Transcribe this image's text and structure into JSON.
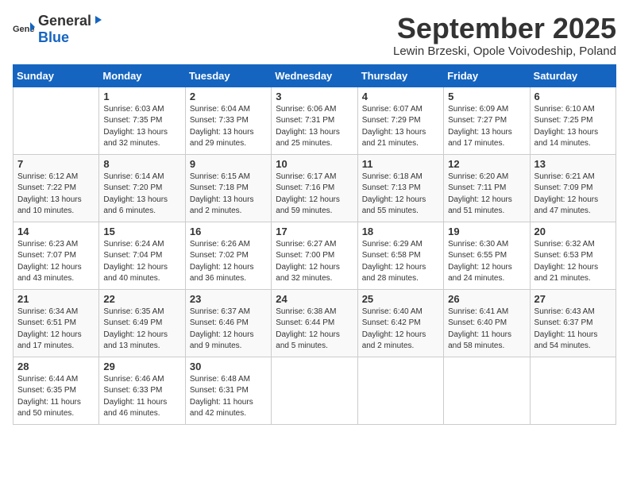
{
  "header": {
    "logo_general": "General",
    "logo_blue": "Blue",
    "month_title": "September 2025",
    "location": "Lewin Brzeski, Opole Voivodeship, Poland"
  },
  "weekdays": [
    "Sunday",
    "Monday",
    "Tuesday",
    "Wednesday",
    "Thursday",
    "Friday",
    "Saturday"
  ],
  "weeks": [
    [
      {
        "day": "",
        "info": ""
      },
      {
        "day": "1",
        "info": "Sunrise: 6:03 AM\nSunset: 7:35 PM\nDaylight: 13 hours\nand 32 minutes."
      },
      {
        "day": "2",
        "info": "Sunrise: 6:04 AM\nSunset: 7:33 PM\nDaylight: 13 hours\nand 29 minutes."
      },
      {
        "day": "3",
        "info": "Sunrise: 6:06 AM\nSunset: 7:31 PM\nDaylight: 13 hours\nand 25 minutes."
      },
      {
        "day": "4",
        "info": "Sunrise: 6:07 AM\nSunset: 7:29 PM\nDaylight: 13 hours\nand 21 minutes."
      },
      {
        "day": "5",
        "info": "Sunrise: 6:09 AM\nSunset: 7:27 PM\nDaylight: 13 hours\nand 17 minutes."
      },
      {
        "day": "6",
        "info": "Sunrise: 6:10 AM\nSunset: 7:25 PM\nDaylight: 13 hours\nand 14 minutes."
      }
    ],
    [
      {
        "day": "7",
        "info": "Sunrise: 6:12 AM\nSunset: 7:22 PM\nDaylight: 13 hours\nand 10 minutes."
      },
      {
        "day": "8",
        "info": "Sunrise: 6:14 AM\nSunset: 7:20 PM\nDaylight: 13 hours\nand 6 minutes."
      },
      {
        "day": "9",
        "info": "Sunrise: 6:15 AM\nSunset: 7:18 PM\nDaylight: 13 hours\nand 2 minutes."
      },
      {
        "day": "10",
        "info": "Sunrise: 6:17 AM\nSunset: 7:16 PM\nDaylight: 12 hours\nand 59 minutes."
      },
      {
        "day": "11",
        "info": "Sunrise: 6:18 AM\nSunset: 7:13 PM\nDaylight: 12 hours\nand 55 minutes."
      },
      {
        "day": "12",
        "info": "Sunrise: 6:20 AM\nSunset: 7:11 PM\nDaylight: 12 hours\nand 51 minutes."
      },
      {
        "day": "13",
        "info": "Sunrise: 6:21 AM\nSunset: 7:09 PM\nDaylight: 12 hours\nand 47 minutes."
      }
    ],
    [
      {
        "day": "14",
        "info": "Sunrise: 6:23 AM\nSunset: 7:07 PM\nDaylight: 12 hours\nand 43 minutes."
      },
      {
        "day": "15",
        "info": "Sunrise: 6:24 AM\nSunset: 7:04 PM\nDaylight: 12 hours\nand 40 minutes."
      },
      {
        "day": "16",
        "info": "Sunrise: 6:26 AM\nSunset: 7:02 PM\nDaylight: 12 hours\nand 36 minutes."
      },
      {
        "day": "17",
        "info": "Sunrise: 6:27 AM\nSunset: 7:00 PM\nDaylight: 12 hours\nand 32 minutes."
      },
      {
        "day": "18",
        "info": "Sunrise: 6:29 AM\nSunset: 6:58 PM\nDaylight: 12 hours\nand 28 minutes."
      },
      {
        "day": "19",
        "info": "Sunrise: 6:30 AM\nSunset: 6:55 PM\nDaylight: 12 hours\nand 24 minutes."
      },
      {
        "day": "20",
        "info": "Sunrise: 6:32 AM\nSunset: 6:53 PM\nDaylight: 12 hours\nand 21 minutes."
      }
    ],
    [
      {
        "day": "21",
        "info": "Sunrise: 6:34 AM\nSunset: 6:51 PM\nDaylight: 12 hours\nand 17 minutes."
      },
      {
        "day": "22",
        "info": "Sunrise: 6:35 AM\nSunset: 6:49 PM\nDaylight: 12 hours\nand 13 minutes."
      },
      {
        "day": "23",
        "info": "Sunrise: 6:37 AM\nSunset: 6:46 PM\nDaylight: 12 hours\nand 9 minutes."
      },
      {
        "day": "24",
        "info": "Sunrise: 6:38 AM\nSunset: 6:44 PM\nDaylight: 12 hours\nand 5 minutes."
      },
      {
        "day": "25",
        "info": "Sunrise: 6:40 AM\nSunset: 6:42 PM\nDaylight: 12 hours\nand 2 minutes."
      },
      {
        "day": "26",
        "info": "Sunrise: 6:41 AM\nSunset: 6:40 PM\nDaylight: 11 hours\nand 58 minutes."
      },
      {
        "day": "27",
        "info": "Sunrise: 6:43 AM\nSunset: 6:37 PM\nDaylight: 11 hours\nand 54 minutes."
      }
    ],
    [
      {
        "day": "28",
        "info": "Sunrise: 6:44 AM\nSunset: 6:35 PM\nDaylight: 11 hours\nand 50 minutes."
      },
      {
        "day": "29",
        "info": "Sunrise: 6:46 AM\nSunset: 6:33 PM\nDaylight: 11 hours\nand 46 minutes."
      },
      {
        "day": "30",
        "info": "Sunrise: 6:48 AM\nSunset: 6:31 PM\nDaylight: 11 hours\nand 42 minutes."
      },
      {
        "day": "",
        "info": ""
      },
      {
        "day": "",
        "info": ""
      },
      {
        "day": "",
        "info": ""
      },
      {
        "day": "",
        "info": ""
      }
    ]
  ]
}
